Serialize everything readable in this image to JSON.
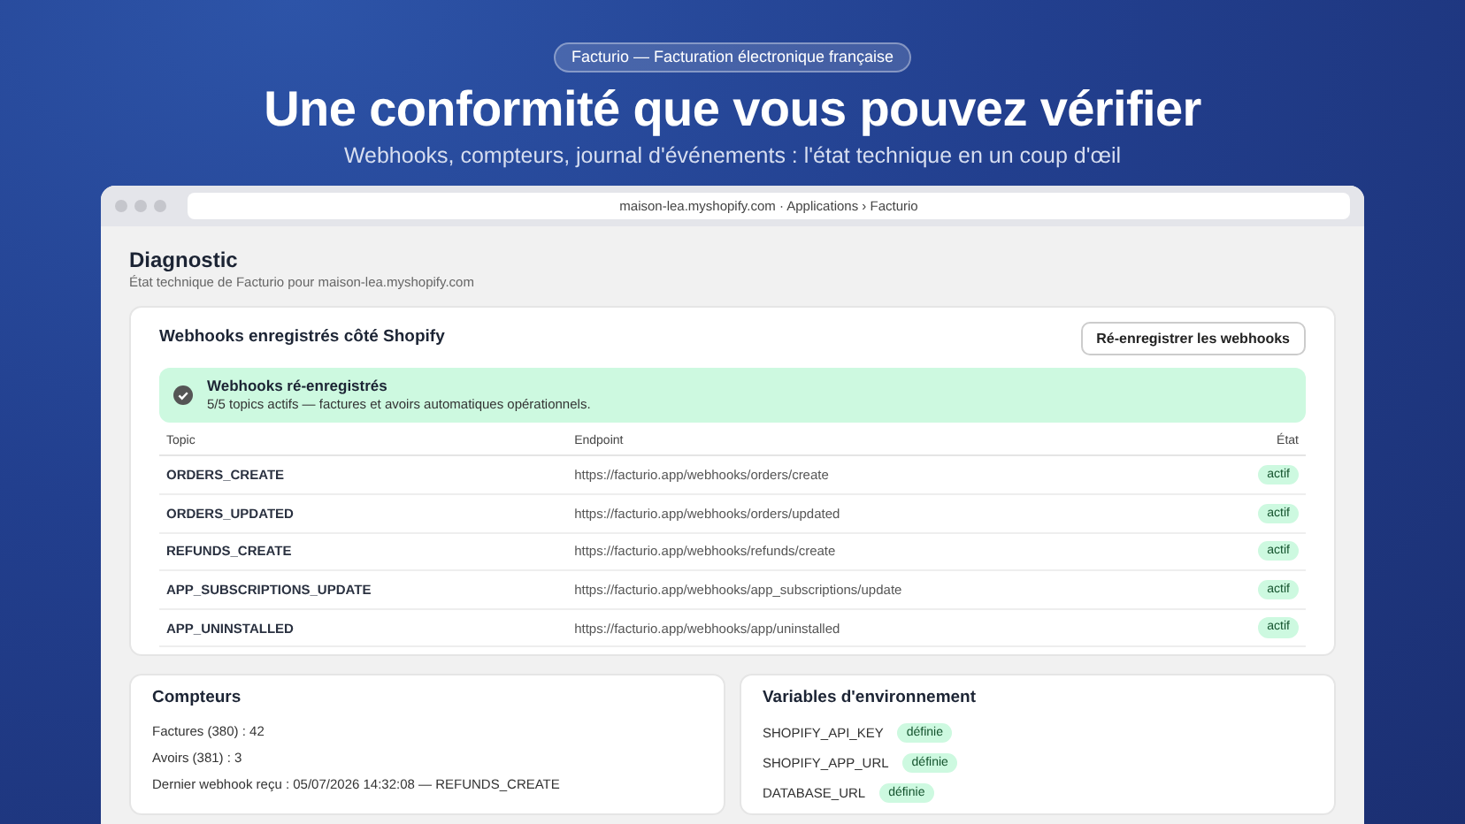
{
  "hero": {
    "badge": "Facturio — Facturation électronique française",
    "title": "Une conformité que vous pouvez vérifier",
    "subtitle": "Webhooks, compteurs, journal d'événements : l'état technique en un coup d'œil"
  },
  "browser": {
    "address": "maison-lea.myshopify.com · Applications › Facturio"
  },
  "page": {
    "title": "Diagnostic",
    "subtitle": "État technique de Facturio pour maison-lea.myshopify.com"
  },
  "webhooks": {
    "title": "Webhooks enregistrés côté Shopify",
    "button": "Ré-enregistrer les webhooks",
    "alert": {
      "kind": "success",
      "title": "Webhooks ré-enregistrés",
      "text": "5/5 topics actifs — factures et avoirs automatiques opérationnels."
    },
    "columns": [
      "Topic",
      "Endpoint",
      "État"
    ],
    "rows": [
      {
        "topic": "ORDERS_CREATE",
        "endpoint": "https://facturio.app/webhooks/orders/create",
        "state": "actif",
        "active": true
      },
      {
        "topic": "ORDERS_UPDATED",
        "endpoint": "https://facturio.app/webhooks/orders/updated",
        "state": "actif",
        "active": true
      },
      {
        "topic": "REFUNDS_CREATE",
        "endpoint": "https://facturio.app/webhooks/refunds/create",
        "state": "actif",
        "active": true
      },
      {
        "topic": "APP_SUBSCRIPTIONS_UPDATE",
        "endpoint": "https://facturio.app/webhooks/app_subscriptions/update",
        "state": "actif",
        "active": true
      },
      {
        "topic": "APP_UNINSTALLED",
        "endpoint": "https://facturio.app/webhooks/app/uninstalled",
        "state": "actif",
        "active": true
      }
    ]
  },
  "counters": {
    "title": "Compteurs",
    "lines": [
      "Factures (380) : 42",
      "Avoirs (381) : 3",
      "Dernier webhook reçu : 05/07/2026 14:32:08 — REFUNDS_CREATE"
    ]
  },
  "env": {
    "title": "Variables d'environnement",
    "vars": [
      {
        "name": "SHOPIFY_API_KEY",
        "state": "définie",
        "defined": true
      },
      {
        "name": "SHOPIFY_APP_URL",
        "state": "définie",
        "defined": true
      },
      {
        "name": "DATABASE_URL",
        "state": "définie",
        "defined": true
      }
    ]
  }
}
